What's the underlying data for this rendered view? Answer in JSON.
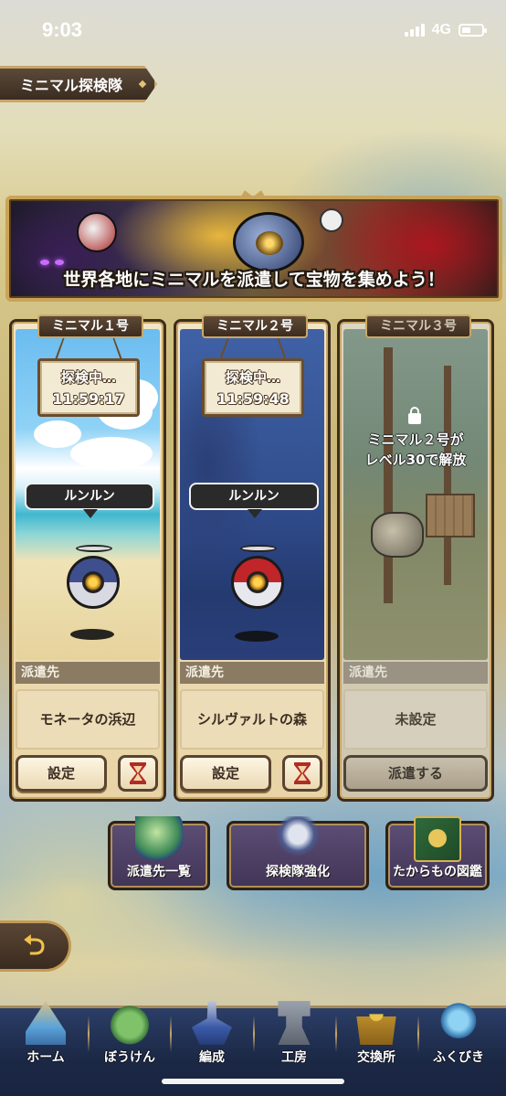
{
  "status_bar": {
    "time": "9:03",
    "network": "4G"
  },
  "header": {
    "title": "ミニマル探検隊"
  },
  "banner": {
    "text": "世界各地にミニマルを派遣して宝物を集めよう！"
  },
  "expeditions": [
    {
      "name": "ミニマル１号",
      "status": "探検中…",
      "timer": "11:59:17",
      "speech": "ルンルン",
      "destination_label": "派遣先",
      "destination": "モネータの浜辺",
      "set_button": "設定",
      "robot_color": "#3f4f8e"
    },
    {
      "name": "ミニマル２号",
      "status": "探検中…",
      "timer": "11:59:48",
      "speech": "ルンルン",
      "destination_label": "派遣先",
      "destination": "シルヴァルトの森",
      "set_button": "設定",
      "robot_color": "#c0252a"
    },
    {
      "name": "ミニマル３号",
      "lock_line1": "ミニマル２号が",
      "lock_line2": "レベル30で解放",
      "destination_label": "派遣先",
      "destination": "未設定",
      "dispatch_button": "派遣する"
    }
  ],
  "features": [
    {
      "label": "派遣先一覧",
      "icon": "globe-icon"
    },
    {
      "label": "探検隊強化",
      "icon": "robot-icon"
    },
    {
      "label": "たからもの図鑑",
      "icon": "treasure-book-icon"
    }
  ],
  "nav": [
    {
      "label": "ホーム",
      "icon": "home-tent-icon"
    },
    {
      "label": "ぼうけん",
      "icon": "island-icon"
    },
    {
      "label": "編成",
      "icon": "knight-icon"
    },
    {
      "label": "工房",
      "icon": "anvil-icon"
    },
    {
      "label": "交換所",
      "icon": "scales-icon"
    },
    {
      "label": "ふくびき",
      "icon": "crystal-orb-icon"
    }
  ]
}
